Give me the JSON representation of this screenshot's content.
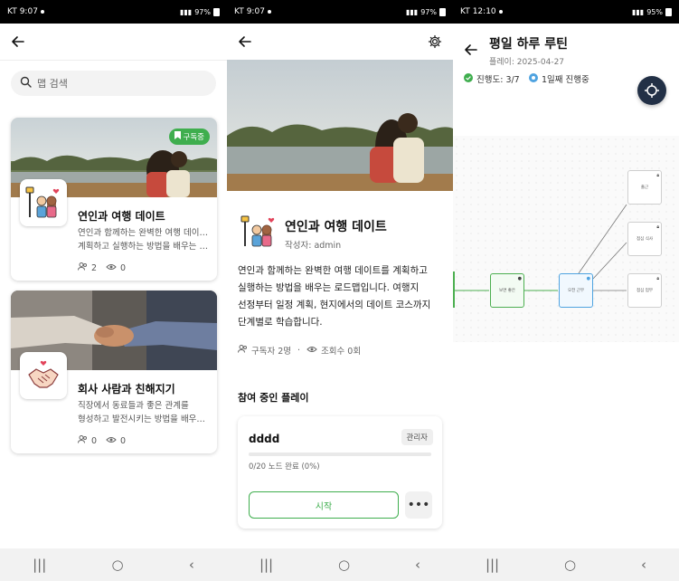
{
  "screens": {
    "list": {
      "status": {
        "carrier": "KT",
        "time": "9:07",
        "battery": "97%"
      },
      "search": {
        "placeholder": "맵 검색"
      },
      "cards": [
        {
          "title": "연인과 여행 데이트",
          "desc1": "연인과 함께하는 완벽한 여행 데이트를",
          "desc2": "계획하고 실행하는 방법을 배우는 로...",
          "subscribers": "2",
          "views": "0",
          "badge": "구독중"
        },
        {
          "title": "회사 사람과 친해지기",
          "desc1": "직장에서 동료들과 좋은 관계를",
          "desc2": "형성하고 발전시키는 방법을 배우는 로...",
          "subscribers": "0",
          "views": "0"
        }
      ]
    },
    "detail": {
      "status": {
        "carrier": "KT",
        "time": "9:07",
        "battery": "97%"
      },
      "title": "연인과 여행 데이트",
      "author": "작성자: admin",
      "desc_lines": [
        "연인과 함께하는 완벽한 여행 데이트를 계획하고",
        "실행하는 방법을 배우는 로드맵입니다. 여행지",
        "선정부터 일정 계획, 현지에서의 데이트 코스까지",
        "단계별로 학습합니다."
      ],
      "subscribers": "구독자 2명",
      "views": "조회수 0회",
      "section_title": "참여 중인 플레이",
      "play": {
        "name": "dddd",
        "badge": "관리자",
        "progress_text": "0/20 노드 완료 (0%)",
        "progress_pct": 0,
        "start_label": "시작",
        "more_label": "•••"
      }
    },
    "routine": {
      "status": {
        "carrier": "KT",
        "time": "12:10",
        "battery": "95%"
      },
      "title": "평일 하루 루틴",
      "subtitle": "플레이: 2025-04-27",
      "progress": "진행도: 3/7",
      "day": "1일째 진행중",
      "nodes": [
        "보면 좋은",
        "오전 근무",
        "출근",
        "점심 식사",
        "점심 업무"
      ]
    }
  },
  "nav": {
    "recents": "|||",
    "home": "○",
    "back": "‹"
  },
  "colors": {
    "accent_green": "#3fae4e",
    "accent_blue": "#4fa3e0",
    "dark_button": "#223046"
  }
}
